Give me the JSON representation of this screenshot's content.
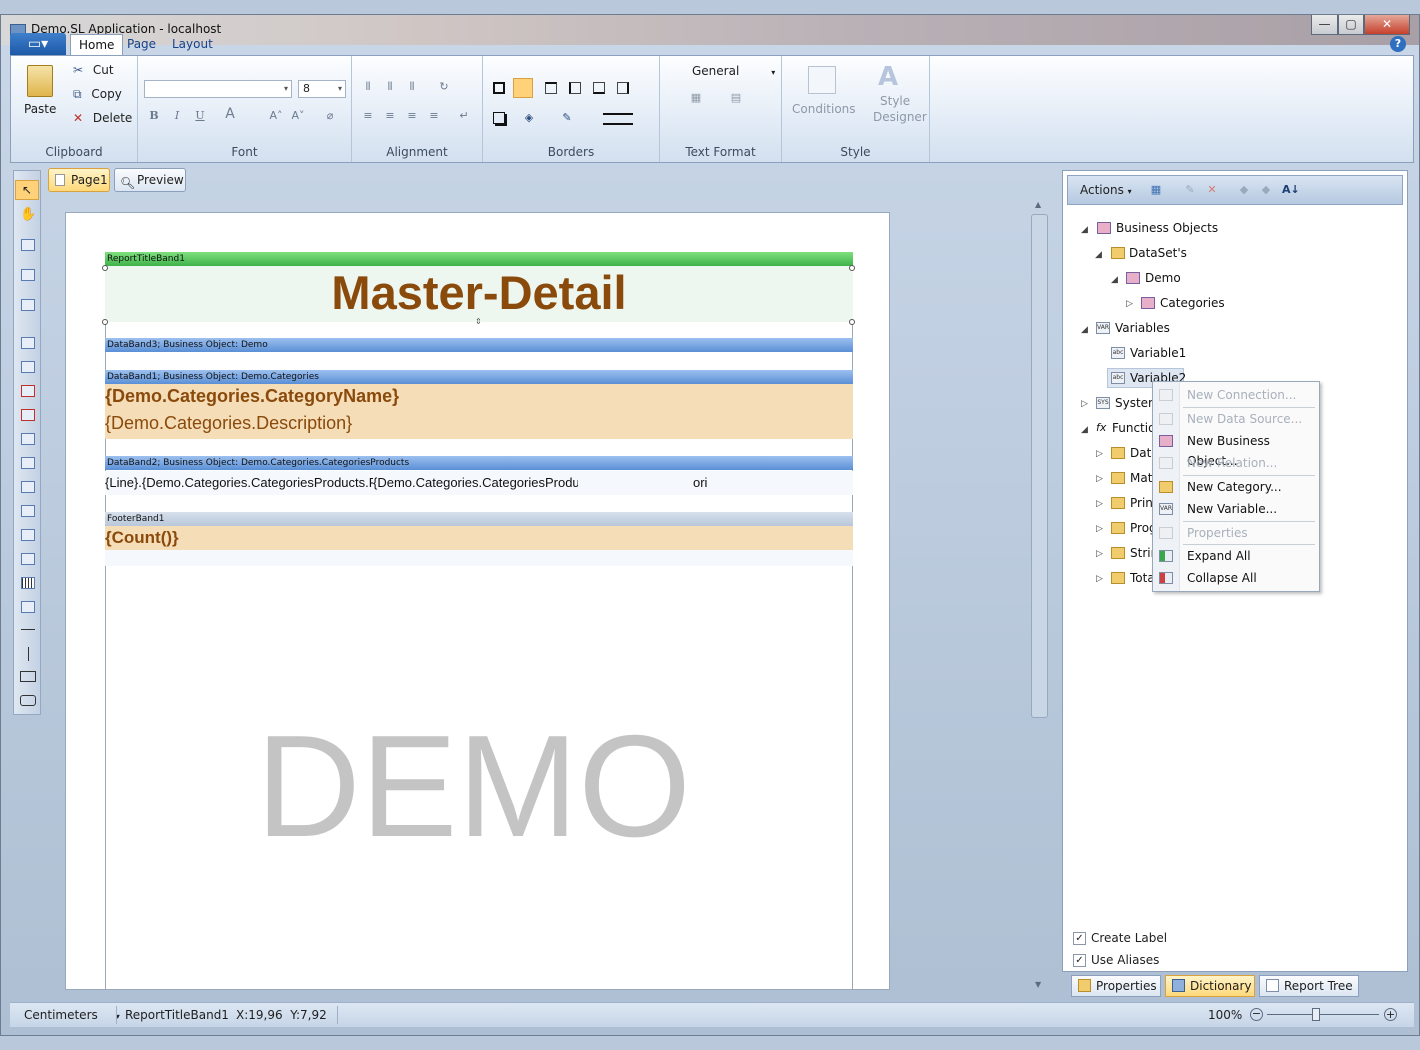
{
  "window": {
    "title": "Demo.SL Application - localhost",
    "min": "—",
    "max": "▢",
    "close": "✕"
  },
  "ribbon": {
    "tabs": [
      "Home",
      "Page",
      "Layout"
    ],
    "clipboard": {
      "paste": "Paste",
      "cut": "Cut",
      "copy": "Copy",
      "delete": "Delete",
      "label": "Clipboard"
    },
    "font": {
      "font_name": "",
      "font_size": "8",
      "label": "Font"
    },
    "alignment": {
      "label": "Alignment"
    },
    "borders": {
      "label": "Borders"
    },
    "text_format": {
      "value": "General",
      "label": "Text Format"
    },
    "style": {
      "conditions": "Conditions",
      "style_designer_1": "Style",
      "style_designer_2": "Designer",
      "label": "Style"
    },
    "help": "?"
  },
  "doc_tabs": {
    "page1": "Page1",
    "preview": "Preview"
  },
  "report": {
    "title_band": "ReportTitleBand1",
    "title_text": "Master-Detail",
    "data_band3": "DataBand3; Business Object: Demo",
    "data_band1": "DataBand1; Business Object: Demo.Categories",
    "category_name": "{Demo.Categories.CategoryName}",
    "category_desc": "{Demo.Categories.Description}",
    "data_band2": "DataBand2; Business Object: Demo.Categories.CategoriesProducts",
    "detail_1": "{Line}.{Demo.Categories.CategoriesProducts.F",
    "detail_2": "{Demo.Categories.CategoriesProdu",
    "detail_3": "ori",
    "footer_band": "FooterBand1",
    "footer_count": "{Count()}",
    "watermark": "DEMO"
  },
  "dictionary": {
    "actions": "Actions",
    "tree": {
      "business_objects": "Business Objects",
      "datasets": "DataSet's",
      "demo": "Demo",
      "categories": "Categories",
      "variables": "Variables",
      "variable1": "Variable1",
      "variable2": "Variable2",
      "system": "System",
      "functions": "Function",
      "date": "Date",
      "math": "Mat",
      "print": "Prin",
      "prog": "Prog",
      "strings": "Strir",
      "totals": "Tota"
    },
    "create_label": "Create Label",
    "use_aliases": "Use Aliases"
  },
  "context_menu": {
    "items": [
      "New Connection...",
      "New Data Source...",
      "New Business Object...",
      "New Relation...",
      "New Category...",
      "New Variable...",
      "Properties",
      "Expand All",
      "Collapse All"
    ]
  },
  "bottom_tabs": {
    "properties": "Properties",
    "dictionary": "Dictionary",
    "report_tree": "Report Tree"
  },
  "status": {
    "units": "Centimeters",
    "component": "ReportTitleBand1",
    "coords": "X:19,96  Y:7,92",
    "zoom": "100%"
  }
}
